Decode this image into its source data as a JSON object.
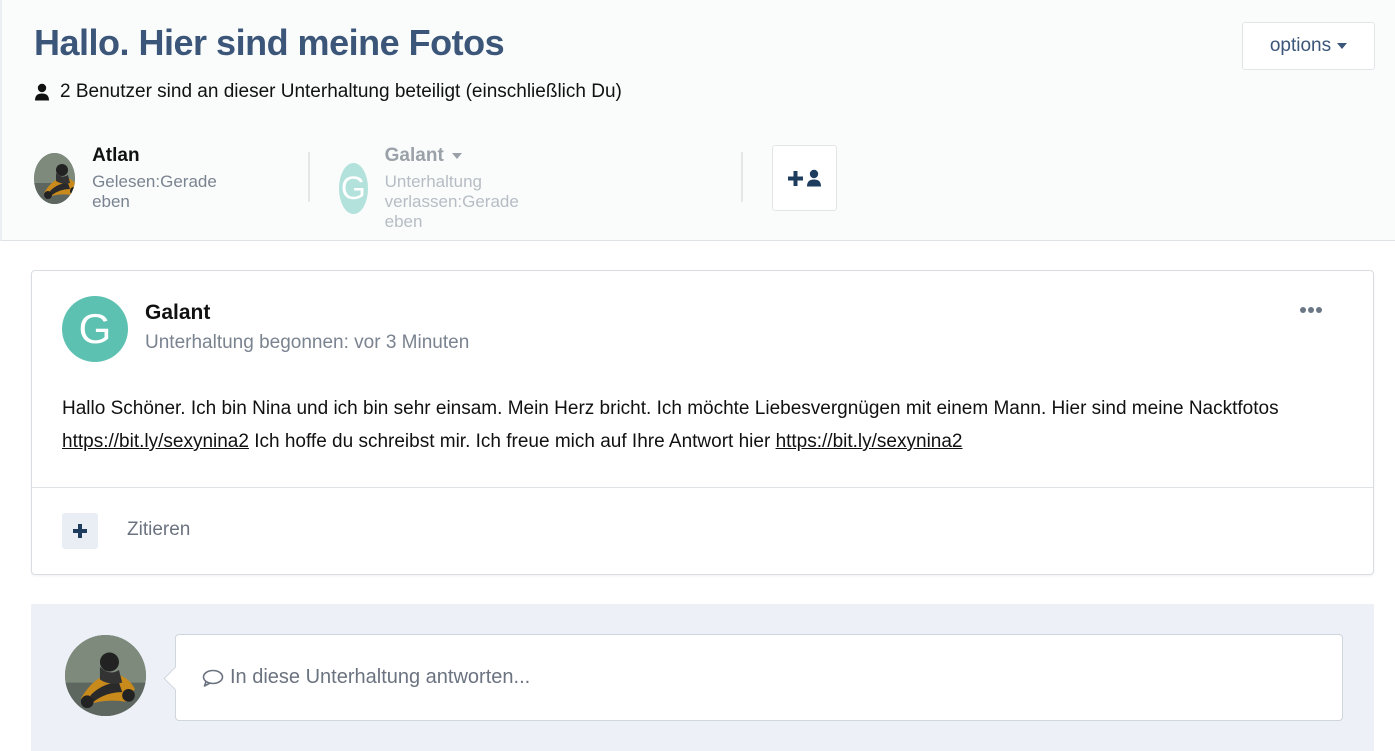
{
  "header": {
    "title": "Hallo. Hier sind meine Fotos",
    "options_label": "options",
    "participants_summary": "2 Benutzer sind an dieser Unterhaltung beteiligt (einschließlich Du)"
  },
  "participants": [
    {
      "name": "Atlan",
      "status": "Gelesen:Gerade eben",
      "avatar": "photo"
    },
    {
      "name": "Galant",
      "status": "Unterhaltung verlassen:Gerade eben",
      "avatar_letter": "G"
    }
  ],
  "post": {
    "avatar_letter": "G",
    "author": "Galant",
    "meta": "Unterhaltung begonnen: vor 3 Minuten",
    "body_part1": "Hallo Schöner. Ich bin Nina und ich bin sehr einsam. Mein Herz bricht. Ich möchte Liebesvergnügen mit einem Mann. Hier sind meine Nacktfotos ",
    "link1": "https://bit.ly/sexynina2",
    "body_part2": " Ich hoffe du schreibst mir. Ich freue mich auf Ihre Antwort hier ",
    "link2": "https://bit.ly/sexynina2",
    "quote_label": "Zitieren"
  },
  "reply": {
    "placeholder": "In diese Unterhaltung antworten..."
  },
  "colors": {
    "title": "#3b5679",
    "galant_avatar": "#5dc1b2",
    "galant_avatar_dim": "#b3e2dc",
    "reply_background": "#edf1f7"
  }
}
